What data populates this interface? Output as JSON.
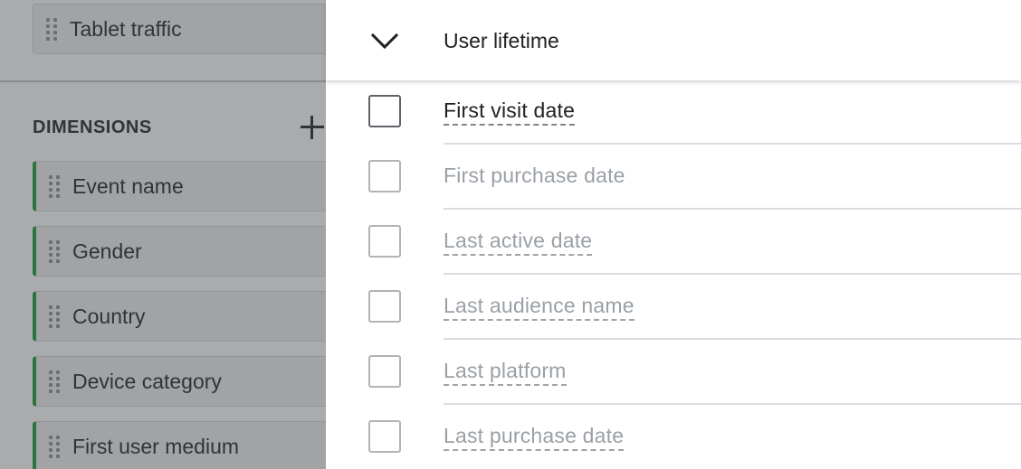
{
  "left_panel": {
    "segment_chip": {
      "label": "Tablet traffic"
    },
    "dimensions_header": "DIMENSIONS",
    "add_icon": "plus-icon",
    "dimensions": [
      {
        "label": "Event name"
      },
      {
        "label": "Gender"
      },
      {
        "label": "Country"
      },
      {
        "label": "Device category"
      },
      {
        "label": "First user medium"
      }
    ],
    "accent_color": "#34a853"
  },
  "drawer": {
    "group": {
      "icon": "chevron-down-icon",
      "title": "User lifetime"
    },
    "options": [
      {
        "label": "First visit date",
        "checked": false,
        "enabled": true,
        "has_tooltip": true
      },
      {
        "label": "First purchase date",
        "checked": false,
        "enabled": false,
        "has_tooltip": false
      },
      {
        "label": "Last active date",
        "checked": false,
        "enabled": false,
        "has_tooltip": true
      },
      {
        "label": "Last audience name",
        "checked": false,
        "enabled": false,
        "has_tooltip": true
      },
      {
        "label": "Last platform",
        "checked": false,
        "enabled": false,
        "has_tooltip": true
      },
      {
        "label": "Last purchase date",
        "checked": false,
        "enabled": false,
        "has_tooltip": true
      }
    ]
  }
}
